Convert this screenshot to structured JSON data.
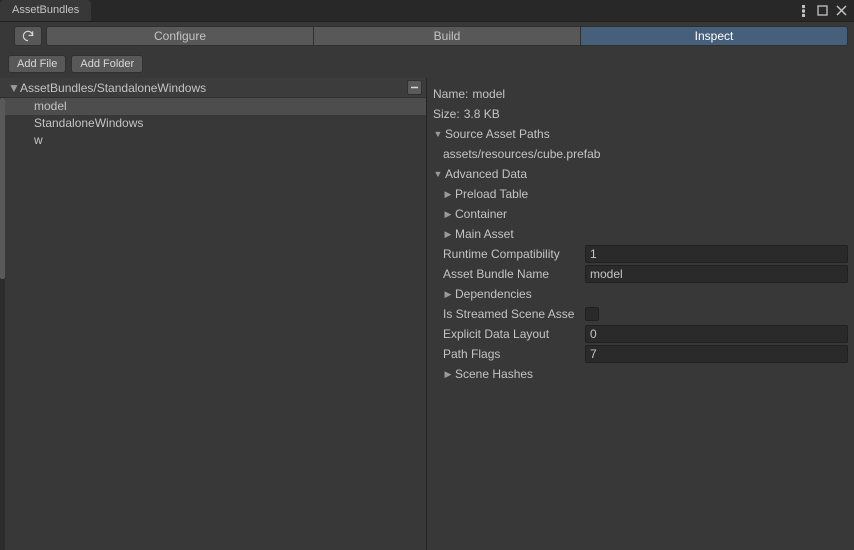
{
  "window": {
    "title": "AssetBundles"
  },
  "toolbar": {
    "refresh_icon": "refresh",
    "modes": {
      "configure": "Configure",
      "build": "Build",
      "inspect": "Inspect",
      "active": "inspect"
    }
  },
  "second_toolbar": {
    "add_file": "Add File",
    "add_folder": "Add Folder"
  },
  "tree": {
    "root_label": "AssetBundles/StandaloneWindows",
    "items": [
      {
        "label": "model",
        "selected": true
      },
      {
        "label": "StandaloneWindows",
        "selected": false
      },
      {
        "label": "w",
        "selected": false
      }
    ]
  },
  "inspector": {
    "name_label": "Name:",
    "name_value": "model",
    "size_label": "Size:",
    "size_value": "3.8 KB",
    "source_paths": {
      "label": "Source Asset Paths",
      "items": [
        "assets/resources/cube.prefab"
      ]
    },
    "advanced": {
      "label": "Advanced Data",
      "preload_table": "Preload Table",
      "container": "Container",
      "main_asset": "Main Asset"
    },
    "runtime_compat": {
      "label": "Runtime Compatibility",
      "value": "1"
    },
    "asset_bundle_name": {
      "label": "Asset Bundle Name",
      "value": "model"
    },
    "dependencies": {
      "label": "Dependencies"
    },
    "is_streamed": {
      "label": "Is Streamed Scene Asse",
      "checked": false
    },
    "explicit_layout": {
      "label": "Explicit Data Layout",
      "value": "0"
    },
    "path_flags": {
      "label": "Path Flags",
      "value": "7"
    },
    "scene_hashes": {
      "label": "Scene Hashes"
    }
  }
}
